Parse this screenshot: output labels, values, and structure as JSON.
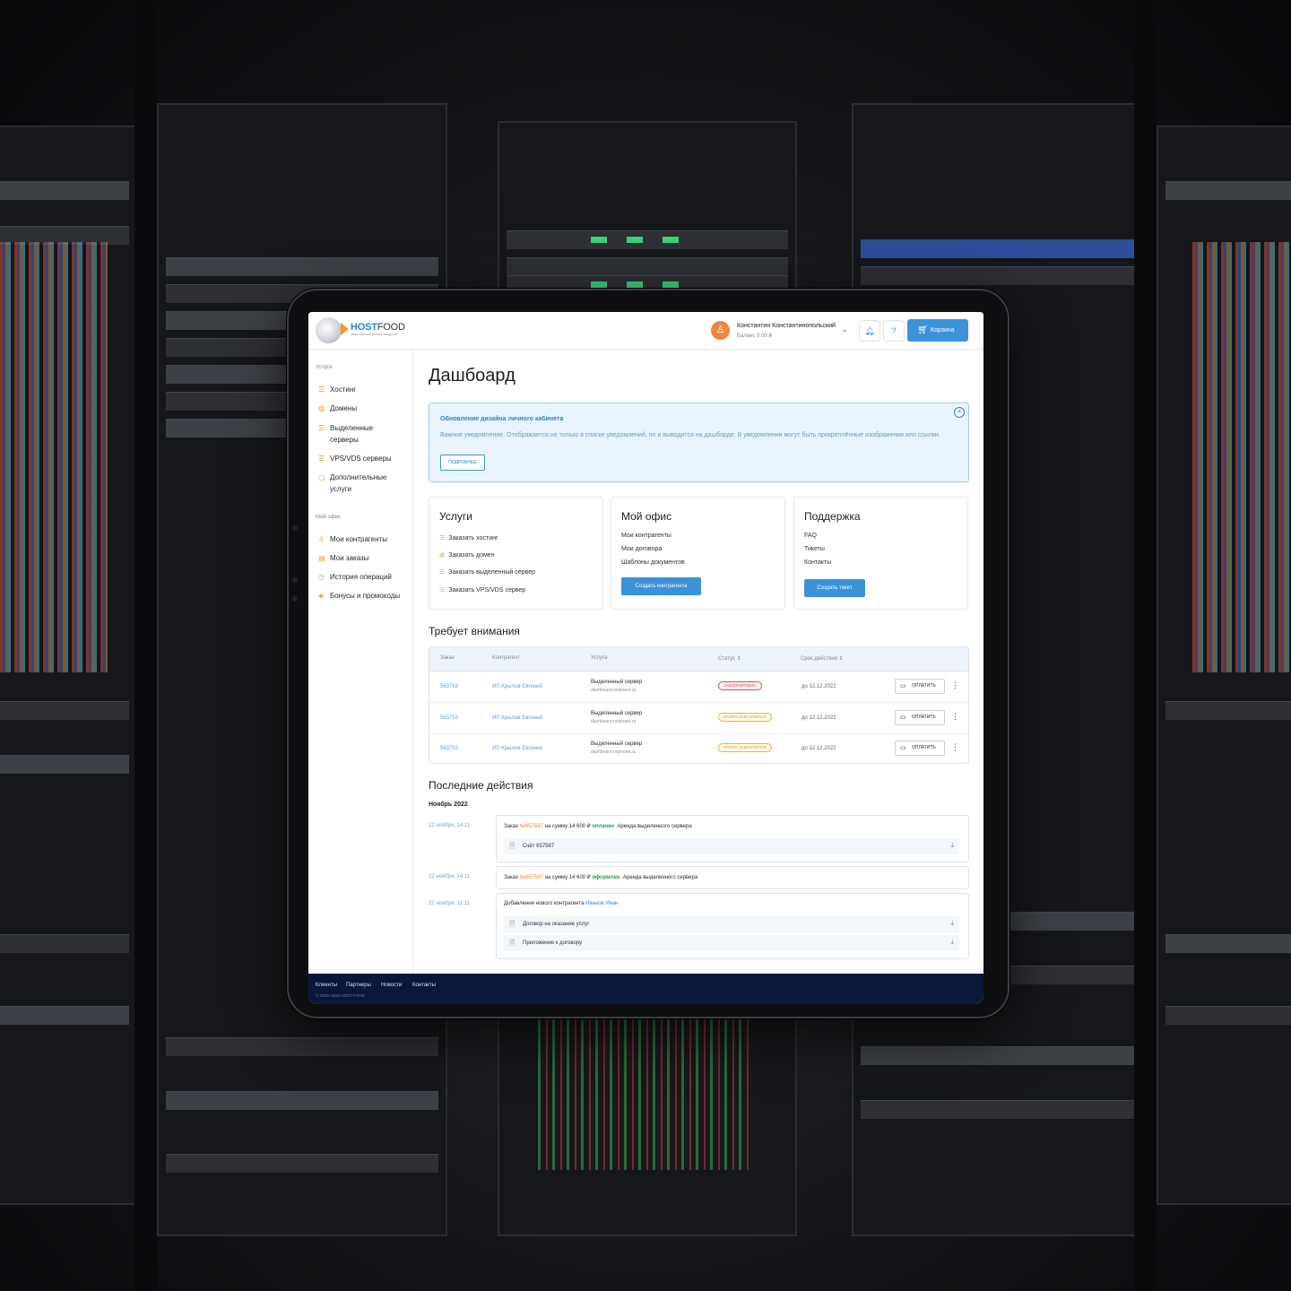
{
  "header": {
    "logo_host": "HOST",
    "logo_food": "FOOD",
    "logo_tagline": "качественный хостинг по-русски",
    "user_name": "Константин Константинопольский",
    "balance": "Баланс 0.00 ₽",
    "cart_label": "Корзина"
  },
  "sidebar": {
    "services_heading": "Услуги",
    "services": [
      {
        "label": "Хостинг",
        "icon": "server-icon"
      },
      {
        "label": "Домены",
        "icon": "globe-icon"
      },
      {
        "label": "Выделенные серверы",
        "icon": "server-icon"
      },
      {
        "label": "VPS/VDS серверы",
        "icon": "server-icon"
      },
      {
        "label": "Дополнительные услуги",
        "icon": "box-icon"
      }
    ],
    "office_heading": "Мой офис",
    "office": [
      {
        "label": "Мои контрагенты",
        "icon": "users-icon"
      },
      {
        "label": "Мои заказы",
        "icon": "document-icon"
      },
      {
        "label": "История операций",
        "icon": "history-icon"
      },
      {
        "label": "Бонусы и промокоды",
        "icon": "tag-icon"
      }
    ]
  },
  "page_title": "Дашбоард",
  "notice": {
    "title": "Обновление дизайна личного кабинета",
    "body": "Важное уведомление. Отображается не только в списке уведомлений, но и выводится на дашборде. В уведомлении могут быть прикреплённые изображения или ссылки.",
    "button": "ПОДРОБНЕЕ"
  },
  "cards": {
    "services": {
      "title": "Услуги",
      "links": [
        "Заказать хостинг",
        "Заказать домен",
        "Заказать выделенный сервер",
        "Заказать VPS/VDS сервер"
      ]
    },
    "office": {
      "title": "Мой офис",
      "links": [
        "Мои контрагенты",
        "Мои договора",
        "Шаблоны документов"
      ],
      "button": "Создать контрагента"
    },
    "support": {
      "title": "Поддержка",
      "links": [
        "FAQ",
        "Тикеты",
        "Контакты"
      ],
      "button": "Создать тикет"
    }
  },
  "attention": {
    "title": "Требует внимания",
    "columns": [
      "Заказ",
      "Контрагент",
      "Услуга",
      "Статус ⇕",
      "Срок действия ⇕"
    ],
    "rows": [
      {
        "order": "563753",
        "contractor": "ИП Крылов Евгений",
        "service": "Выделенный сервер",
        "domain": "dashboard.nopreset.ru",
        "status": "ЗАБЛОКИРОВАН",
        "deadline": "до 12.12.2022",
        "pay": "ОПЛАТИТЬ"
      },
      {
        "order": "563753",
        "contractor": "ИП Крылов Евгений",
        "service": "Выделенный сервер",
        "domain": "dashboard.nopreset.ru",
        "status": "СКОРО ЗАКОНЧИТСЯ",
        "deadline": "до 12.12.2022",
        "pay": "ОПЛАТИТЬ"
      },
      {
        "order": "563753",
        "contractor": "ИП Крылов Евгений",
        "service": "Выделенный сервер",
        "domain": "dashboard.nopreset.ru",
        "status": "СКОРО ЗАКОНЧИТСЯ",
        "deadline": "до 12.12.2022",
        "pay": "ОПЛАТИТЬ"
      }
    ]
  },
  "recent": {
    "title": "Последние действия",
    "month": "Ноябрь 2022",
    "items": [
      {
        "date": "22 ноября, 14:11",
        "prefix": "Заказ",
        "order": "№657587",
        "mid": "на сумму 14 600 ₽",
        "state": "оплачен",
        "desc": "Аренда выделенного сервера",
        "files": [
          "Счёт 657587"
        ]
      },
      {
        "date": "22 ноября, 14:11",
        "prefix": "Заказ",
        "order": "№657587",
        "mid": "на сумму 14 600 ₽",
        "state": "оформлен",
        "desc": "Аренда выделенного сервера",
        "files": []
      },
      {
        "date": "22 ноября, 11:11",
        "prefix": "Добавление нового контрагента",
        "person": "Иванов Иван",
        "files": [
          "Договор на оказание услуг",
          "Приложение к договору"
        ]
      }
    ]
  },
  "footer": {
    "links": [
      "Клиенты",
      "Партнеры",
      "Новости",
      "Контакты"
    ],
    "copyright": "© 2008–2023 HOST-FOOD"
  },
  "colors": {
    "accent": "#3c92d9",
    "orange": "#f39a1d",
    "footer": "#0b1739",
    "notice_bg": "#eaf4fd",
    "danger": "#e24a4a",
    "warning": "#eab72a",
    "success": "#1ea44c"
  }
}
